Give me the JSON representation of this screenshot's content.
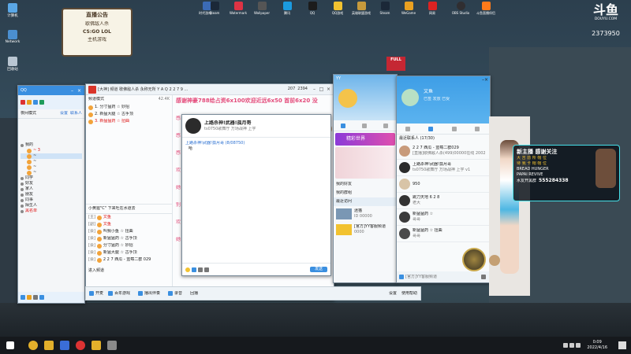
{
  "desktop": {
    "icons": [
      {
        "label": "计算机"
      },
      {
        "label": "Network"
      },
      {
        "label": "回收站"
      }
    ],
    "top_icons": [
      {
        "label": "时代游戏..."
      },
      {
        "label": "Steam"
      },
      {
        "label": "Watermark"
      },
      {
        "label": "Wallpaper"
      },
      {
        "label": "腾讯"
      },
      {
        "label": "QQ"
      },
      {
        "label": "QQ游戏"
      },
      {
        "label": "英雄联盟游戏"
      },
      {
        "label": "Steam"
      },
      {
        "label": "WeGame"
      },
      {
        "label": "网易"
      },
      {
        "label": "OBS Studio"
      },
      {
        "label": "斗鱼直播伴侣"
      }
    ]
  },
  "overlay": {
    "sign_title": "直播公告",
    "sign_line1": "歇佛敌人杀",
    "sign_line2": "CS:GO  LOL",
    "sign_line3": "主机游戏",
    "douyu_logo": "斗鱼",
    "douyu_sub": "DOUYU.COM",
    "room_id": "2373950",
    "banner_title": "新主播 感谢关注",
    "banner_line2": "大 吉 前 所 帽 位",
    "banner_line3": "待 我 卡 帽 帽 位",
    "banner_en1": "BREAD HUNGER",
    "banner_en2": "PAPAI REVIVE",
    "banner_qq_label": "水友开黑群",
    "banner_qq": "555284338"
  },
  "win_qq_main": {
    "title": "QQ",
    "status": "夜间模式",
    "tabs": [
      "设置",
      "联系人"
    ],
    "groups": [
      {
        "label": "我的"
      },
      {
        "label": "同学"
      },
      {
        "label": "好友"
      },
      {
        "label": "家人"
      },
      {
        "label": "朋友"
      },
      {
        "label": "同事"
      },
      {
        "label": "陌生人"
      },
      {
        "label": "黑名单"
      },
      {
        "label": "离线"
      }
    ],
    "sub_items": [
      {
        "label": "~ 3"
      },
      {
        "label": "~"
      },
      {
        "label": "~"
      },
      {
        "label": "~"
      },
      {
        "label": "~"
      }
    ]
  },
  "win_yy": {
    "title": "[大神] 频道    歇佛敌人杀 永称无所 Y A Q 2 2 7 9 ...",
    "counts": [
      "207",
      "2394"
    ],
    "ticker": "感谢神豪788给占资6x100欢迎近远6x50 首前6x20 没",
    "channel_label": "频道模式",
    "channel_count": "42.4K",
    "channels": [
      {
        "text": "1. 分寸猛药 ☆ 妙招"
      },
      {
        "text": "2. 新猛大腿 ☆ 古手顶"
      },
      {
        "text": "3. 新猛猛药 ☆ 扭曲"
      }
    ],
    "member_header": "小黄猩\"C\" 下来吐在水道去",
    "members": [
      {
        "text": "文鱼",
        "tag": "[主]"
      },
      {
        "text": "文鱼",
        "tag": "[副]"
      },
      {
        "text": "叫我小鱼 ☆ 扭曲",
        "tag": "[会]"
      },
      {
        "text": "新猛猛药 ☆ 古手顶",
        "tag": "[会]"
      },
      {
        "text": "分寸猛药 ☆ 妙招",
        "tag": "[会]"
      },
      {
        "text": "新猛大腿 ☆ 古手顶",
        "tag": "[会]"
      },
      {
        "text": "2 2 7 西瓜 - 蓝莓二群 029",
        "tag": "[会]"
      }
    ],
    "chat_title": "上路杀神!武器!孤月哥",
    "chat_subtitle": "ts0750歌舞厅 万场战神 上学",
    "chat_msg_user": "上路杀神!武器!孤月哥 (8/08750)",
    "chat_msg_text": "哈",
    "side_red_lines": [
      "感",
      "感",
      "感",
      "欢",
      "她",
      "别",
      "欢",
      "她"
    ],
    "number_big": "1",
    "send_label": "发送",
    "bottom_items": [
      "百年游戏",
      "播出伴奏",
      "录音",
      "回播"
    ],
    "mic_status": "开麦",
    "bottom_right": [
      "设置",
      "使用帮助"
    ],
    "enter_label": "进入频道"
  },
  "win_qq_profile": {
    "title": "YY",
    "fans_label": "精彩世界",
    "list_items": [
      {
        "label": "我的好友"
      },
      {
        "label": "我的群组"
      },
      {
        "label": "最近访问"
      }
    ],
    "card_name": "迷猫",
    "card_sub": "ID 00000",
    "card2_name": "[官方]YY客服频道",
    "card2_sub": "0000"
  },
  "win_qq_chat": {
    "title": "文鱼",
    "signature": "已签 发放 已受",
    "recent_label": "最近联系人 (17/30)",
    "contacts": [
      {
        "name": "2 2 7 西瓜 - 蓝莓二群029",
        "msg": "[直播]歇佛敌人杀(499)00000在线 2002"
      },
      {
        "name": "上路杀神!武器!孤月哥",
        "msg": "ts0750歌舞厅 万场战神 上学 v1"
      },
      {
        "name": "950",
        "msg": ""
      },
      {
        "name": "跳刀天地 6 2 8",
        "msg": "老大"
      },
      {
        "name": "新猛猛药 ☆",
        "msg": "哥哥"
      },
      {
        "name": "新猛猛药 ☆ 扭曲",
        "msg": "哥哥"
      }
    ],
    "footer": "[官方]YY客服频道"
  },
  "taskbar": {
    "time": "0:09",
    "date": "2022/4/16"
  }
}
